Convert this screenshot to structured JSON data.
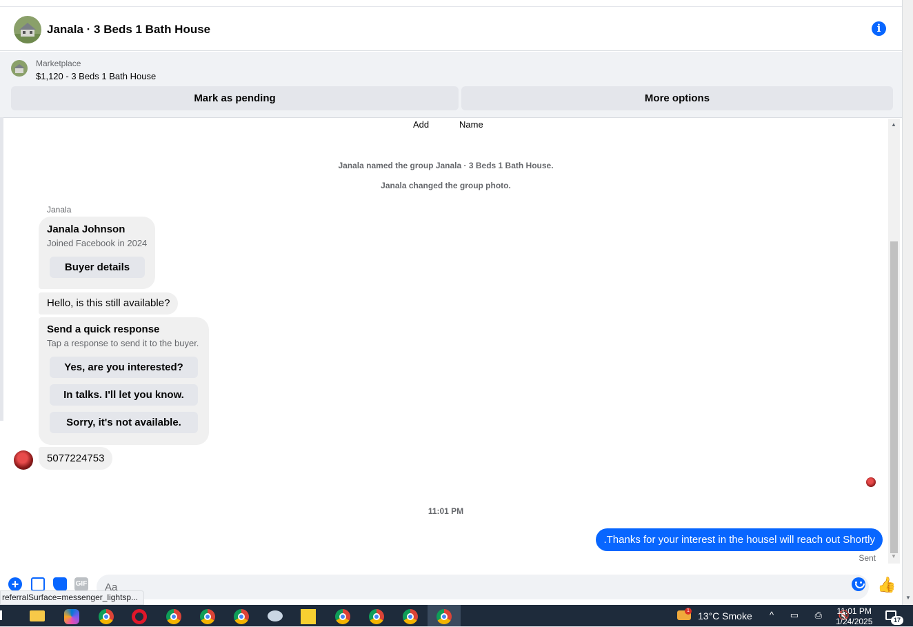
{
  "header": {
    "title": "Janala · 3 Beds 1 Bath House",
    "info_icon": "info-icon"
  },
  "listing": {
    "source": "Marketplace",
    "price_title": "$1,120 - 3 Beds 1 Bath House",
    "mark_pending_label": "Mark as pending",
    "more_options_label": "More options"
  },
  "thread": {
    "add_label": "Add",
    "name_label": "Name",
    "system_messages": [
      "Janala named the group Janala · 3 Beds 1 Bath House.",
      "Janala changed the group photo."
    ],
    "sender_label": "Janala",
    "profile_card": {
      "name": "Janala Johnson",
      "joined": "Joined Facebook in 2024",
      "button_label": "Buyer details"
    },
    "incoming_message": "Hello, is this still available?",
    "quick_response": {
      "title": "Send a quick response",
      "subtitle": "Tap a response to send it to the buyer.",
      "options": [
        "Yes, are you interested?",
        "In talks. I'll let you know.",
        "Sorry, it's not available."
      ]
    },
    "phone_message": "5077224753",
    "timestamp": "11:01 PM",
    "outgoing_message": ".Thanks for your interest in the housel will reach out Shortly",
    "status": "Sent"
  },
  "composer": {
    "placeholder": "Aa",
    "gif_label": "GIF"
  },
  "status_url": "referralSurface=messenger_lightsp...",
  "taskbar": {
    "weather": "13°C  Smoke",
    "weather_badge": "1",
    "time": "11:01 PM",
    "date": "1/24/2025",
    "notification_count": "17"
  },
  "colors": {
    "accent": "#0866ff",
    "bubble_gray": "#f0f0f0",
    "taskbar": "#1e2b3b"
  }
}
